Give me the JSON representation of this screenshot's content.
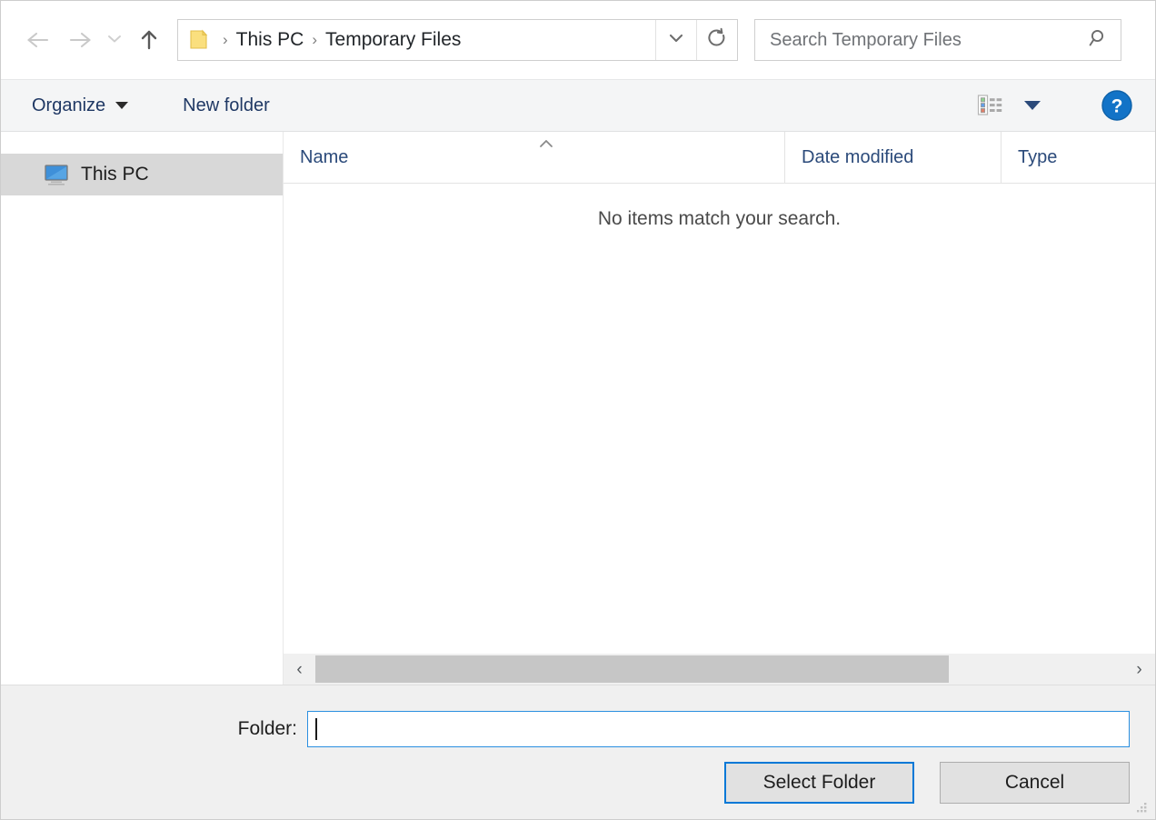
{
  "window": {
    "title": "Select Folder",
    "accent_color": "#0078d7",
    "toolbar_text_color": "#1f3864"
  },
  "addressbar": {
    "back_icon": "arrow-left-icon",
    "forward_icon": "arrow-right-icon",
    "recent_icon": "chevron-down-icon",
    "up_icon": "arrow-up-icon",
    "folder_icon": "folder-icon",
    "separator": "›",
    "crumbs": [
      {
        "label": "This PC"
      },
      {
        "label": "Temporary Files"
      }
    ],
    "dropdown_icon": "chevron-down-icon",
    "refresh_icon": "refresh-icon"
  },
  "search": {
    "placeholder": "Search Temporary Files",
    "value": "",
    "icon": "search-icon"
  },
  "toolbar": {
    "organize_label": "Organize",
    "new_folder_label": "New folder",
    "view_icon": "view-options-icon",
    "view_caret_icon": "chevron-down-icon",
    "help_icon": "help-icon",
    "help_glyph": "?"
  },
  "sidebar": {
    "items": [
      {
        "label": "This PC",
        "icon": "computer-icon",
        "selected": true
      }
    ]
  },
  "filelist": {
    "columns": [
      {
        "label": "Name",
        "sorted": true,
        "sort_direction": "ascending"
      },
      {
        "label": "Date modified",
        "sorted": false
      },
      {
        "label": "Type",
        "sorted": false
      }
    ],
    "rows": [],
    "empty_message": "No items match your search.",
    "sort_caret_icon": "chevron-up-icon"
  },
  "scrollbar": {
    "left_arrow": "‹",
    "right_arrow": "›",
    "orientation": "horizontal"
  },
  "footer": {
    "folder_label": "Folder:",
    "folder_value": "",
    "select_button": "Select Folder",
    "cancel_button": "Cancel",
    "grip_icon": "resize-grip-icon"
  }
}
